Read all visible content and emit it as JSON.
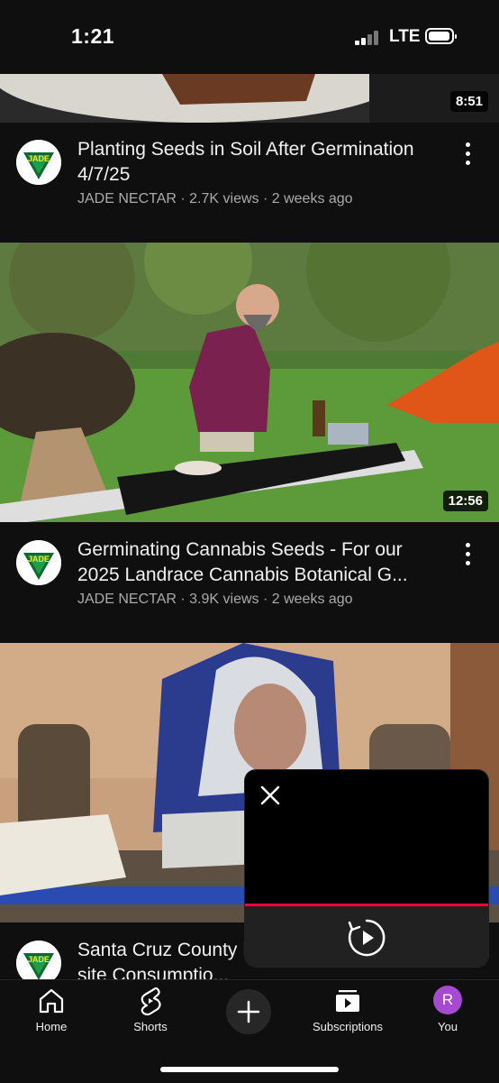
{
  "status_bar": {
    "time": "1:21",
    "network": "LTE",
    "signal_icon": "cellular-signal-icon",
    "battery_icon": "battery-icon"
  },
  "videos": [
    {
      "title": "Planting Seeds in Soil After Germination 4/7/25",
      "meta": "JADE NECTAR · 2.7K views · 2 weeks ago",
      "duration": "8:51",
      "channel_logo_text": "JADE NECTAR"
    },
    {
      "title": "Germinating Cannabis Seeds - For our 2025 Landrace Cannabis Botanical G...",
      "meta": "JADE NECTAR · 3.9K views · 2 weeks ago",
      "duration": "12:56",
      "channel_logo_text": "JADE NECTAR"
    },
    {
      "title": "Santa Cruz County Farm Tours with On-site Consumptio...",
      "meta": "",
      "duration": "",
      "channel_logo_text": "JADE NECTAR"
    }
  ],
  "mini_player": {
    "close_icon": "close-icon",
    "replay_icon": "replay-icon",
    "progress": 1.0,
    "progress_color": "#ff0033"
  },
  "bottom_nav": {
    "items": [
      {
        "label": "Home",
        "icon": "home-icon"
      },
      {
        "label": "Shorts",
        "icon": "shorts-icon"
      },
      {
        "label": "",
        "icon": "create-plus-icon"
      },
      {
        "label": "Subscriptions",
        "icon": "subscriptions-icon"
      },
      {
        "label": "You",
        "icon": "avatar",
        "avatar_letter": "R",
        "avatar_color": "#a64ad1"
      }
    ]
  },
  "colors": {
    "background": "#0f0f0f",
    "text_secondary": "#aaaaaa",
    "accent_red": "#ff0033"
  }
}
